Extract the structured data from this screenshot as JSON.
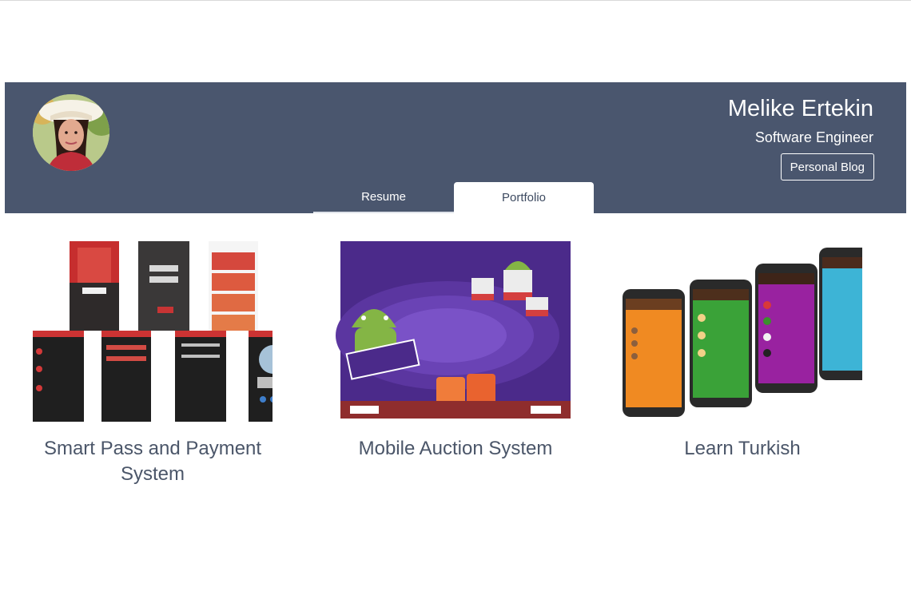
{
  "profile": {
    "name": "Melike Ertekin",
    "title": "Software Engineer",
    "blog_label": "Personal Blog"
  },
  "tabs": [
    {
      "label": "Resume",
      "active": false
    },
    {
      "label": "Portfolio",
      "active": true
    }
  ],
  "projects": [
    {
      "label": "Smart Pass and Payment System"
    },
    {
      "label": "Mobile Auction System"
    },
    {
      "label": "Learn Turkish"
    }
  ],
  "colors": {
    "header_bg": "#4a566e",
    "project_text": "#4b5669",
    "auction_purple": "#4b2a8a",
    "smartpass_red": "#d23a35"
  }
}
